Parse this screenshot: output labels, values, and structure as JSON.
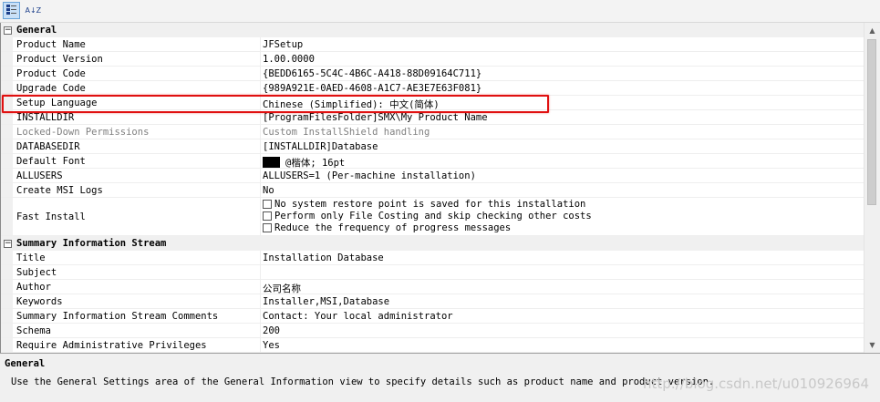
{
  "toolbar": {
    "categorized_icon": "categorized-icon",
    "alphabetical_icon": "alphabetical-icon",
    "alphabetical_glyph": "A↓Z"
  },
  "categories": {
    "general": {
      "toggle": "−",
      "label": "General"
    },
    "summary": {
      "toggle": "−",
      "label": "Summary Information Stream"
    }
  },
  "general_rows": [
    {
      "name": "Product Name",
      "value": "JFSetup"
    },
    {
      "name": "Product Version",
      "value": "1.00.0000"
    },
    {
      "name": "Product Code",
      "value": "{BEDD6165-5C4C-4B6C-A418-88D09164C711}"
    },
    {
      "name": "Upgrade Code",
      "value": "{989A921E-0AED-4608-A1C7-AE3E7E63F081}"
    },
    {
      "name": "Setup Language",
      "value": "Chinese (Simplified): 中文(简体)"
    },
    {
      "name": "INSTALLDIR",
      "value": "[ProgramFilesFolder]SMX\\My Product Name"
    },
    {
      "name": "Locked-Down Permissions",
      "value": "Custom InstallShield handling"
    },
    {
      "name": "DATABASEDIR",
      "value": "[INSTALLDIR]Database"
    },
    {
      "name": "Default Font",
      "value": "@楷体; 16pt"
    },
    {
      "name": "ALLUSERS",
      "value": "ALLUSERS=1 (Per-machine installation)"
    },
    {
      "name": "Create MSI Logs",
      "value": "No"
    }
  ],
  "fast_install": {
    "name": "Fast Install",
    "options": [
      "No system restore point is saved for this installation",
      "Perform only File Costing and skip checking other costs",
      "Reduce the frequency of progress messages"
    ]
  },
  "summary_rows": [
    {
      "name": "Title",
      "value": "Installation Database"
    },
    {
      "name": "Subject",
      "value": ""
    },
    {
      "name": "Author",
      "value": "公司名称"
    },
    {
      "name": "Keywords",
      "value": "Installer,MSI,Database"
    },
    {
      "name": "Summary Information Stream Comments",
      "value": "Contact:  Your local administrator"
    },
    {
      "name": "Schema",
      "value": "200"
    },
    {
      "name": "Require Administrative Privileges",
      "value": "Yes"
    }
  ],
  "scrollbar": {
    "up": "▲",
    "down": "▼"
  },
  "help": {
    "title": "General",
    "text": "Use the General Settings area of the General Information view to specify details such as product name and product version.",
    "watermark": "http://blog.csdn.net/u010926964"
  },
  "colors": {
    "highlight": "#e01010",
    "selected_tool": "#c9e0f7"
  }
}
